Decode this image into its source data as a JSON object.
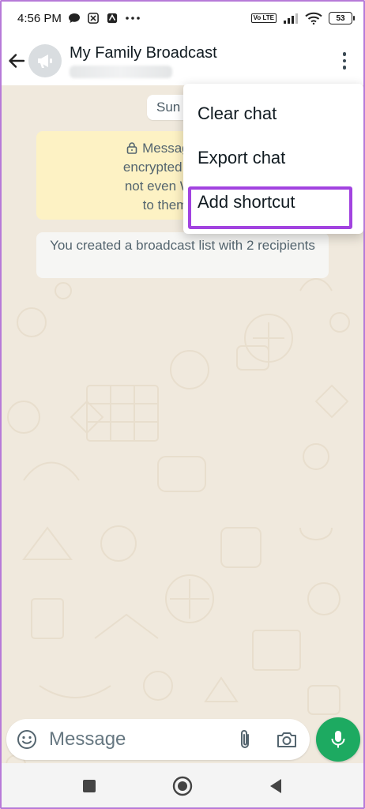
{
  "status_bar": {
    "time": "4:56 PM",
    "battery": "53",
    "icons": [
      "chat-bubble-icon",
      "cross-app-icon",
      "arrow-app-icon",
      "more-dots-icon",
      "volte-icon",
      "signal-icon",
      "wifi-icon",
      "battery-icon"
    ],
    "volte_label": "Vo LTE"
  },
  "header": {
    "title": "My Family Broadcast",
    "avatar_icon": "megaphone-icon"
  },
  "chat": {
    "date_chip": "Sun",
    "encryption_notice": "Messages and c... encrypted. No one o... not even WhatsApp... to them. Tap t...",
    "encryption_lines": [
      "Messages and c",
      "encrypted. No one c",
      "not even WhatsApp",
      "to them. Tap t"
    ],
    "system_message": "You created a broadcast list with 2 recipients"
  },
  "menu": {
    "items": [
      {
        "label": "Clear chat"
      },
      {
        "label": "Export chat"
      },
      {
        "label": "Add shortcut",
        "highlighted": true
      }
    ],
    "highlight_color": "#a243e0"
  },
  "composer": {
    "placeholder": "Message"
  },
  "colors": {
    "accent_green": "#1daa61",
    "chat_background": "#f0e9dd",
    "notice_background": "#fdf2c4"
  }
}
